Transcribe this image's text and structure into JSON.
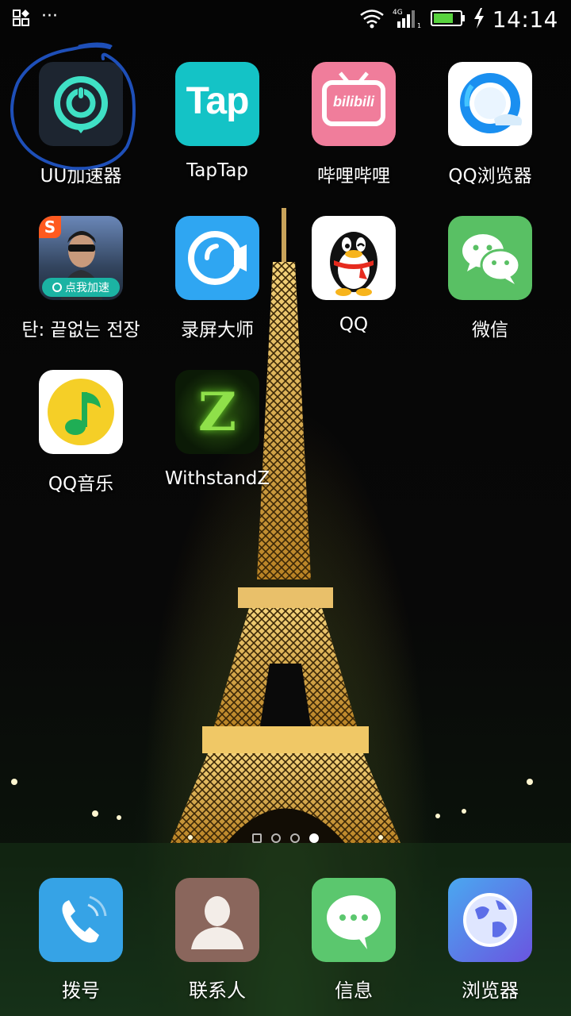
{
  "status_bar": {
    "time": "14:14",
    "network": "4G",
    "icons": [
      "app-switch-icon",
      "more-dots-icon",
      "wifi-icon",
      "signal-icon",
      "battery-icon",
      "charging-icon"
    ]
  },
  "apps": [
    {
      "label": "UU加速器",
      "icon": "uu-accelerator-icon"
    },
    {
      "label": "TapTap",
      "icon": "taptap-icon",
      "icon_text": "Tap"
    },
    {
      "label": "哔哩哔哩",
      "icon": "bilibili-icon",
      "icon_text": "bilibili"
    },
    {
      "label": "QQ浏览器",
      "icon": "qq-browser-icon"
    },
    {
      "label": "탄: 끝없는 전장",
      "icon": "game-soldier-icon",
      "badge": "点我加速",
      "corner": "S"
    },
    {
      "label": "录屏大师",
      "icon": "screen-recorder-icon"
    },
    {
      "label": "QQ",
      "icon": "qq-penguin-icon"
    },
    {
      "label": "微信",
      "icon": "wechat-icon"
    },
    {
      "label": "QQ音乐",
      "icon": "qq-music-icon"
    },
    {
      "label": "WithstandZ",
      "icon": "withstandz-icon",
      "icon_text": "Z"
    }
  ],
  "page_indicator": {
    "pages": 4,
    "active": 4
  },
  "dock": [
    {
      "label": "拨号",
      "icon": "phone-icon"
    },
    {
      "label": "联系人",
      "icon": "contacts-icon"
    },
    {
      "label": "信息",
      "icon": "messages-icon"
    },
    {
      "label": "浏览器",
      "icon": "browser-globe-icon"
    }
  ],
  "colors": {
    "uu_bg": "#1d2530",
    "uu_ring": "#3fe0c5",
    "taptap": "#14c3c6",
    "bilibili": "#f07d9b",
    "recorder": "#2fa6f2",
    "wechat": "#59c064",
    "qqmusic_yellow": "#f5cf27",
    "phone": "#36a3e6",
    "contacts": "#8a665c",
    "messages": "#5bc76e",
    "browser": "#5d6ee8",
    "annotation": "#1e4fb8"
  }
}
